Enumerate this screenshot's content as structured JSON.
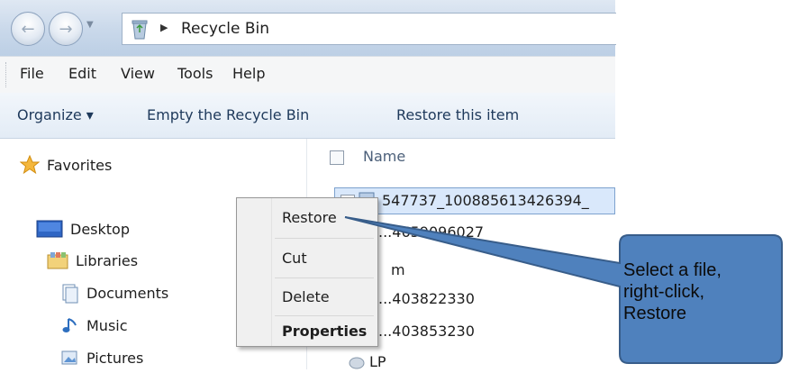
{
  "address": {
    "path": "Recycle Bin"
  },
  "menubar": {
    "items": [
      "File",
      "Edit",
      "View",
      "Tools",
      "Help"
    ]
  },
  "toolbar": {
    "organize": "Organize ▾",
    "empty": "Empty the Recycle Bin",
    "restore": "Restore this item"
  },
  "nav": {
    "favorites": "Favorites",
    "desktop": "Desktop",
    "libraries": "Libraries",
    "documents": "Documents",
    "music": "Music",
    "pictures": "Pictures"
  },
  "list": {
    "column_name": "Name",
    "rows": [
      "547737_100885613426394_",
      "...4659096027",
      "m",
      "...403822330",
      "...403853230",
      "LP"
    ]
  },
  "context_menu": {
    "items": [
      "Restore",
      "Cut",
      "Delete",
      "Properties"
    ]
  },
  "callout": {
    "text_line1": "Select a file,",
    "text_line2": "right-click,",
    "text_line3": "Restore",
    "fill": "#4f81bd",
    "border": "#385d8a"
  }
}
